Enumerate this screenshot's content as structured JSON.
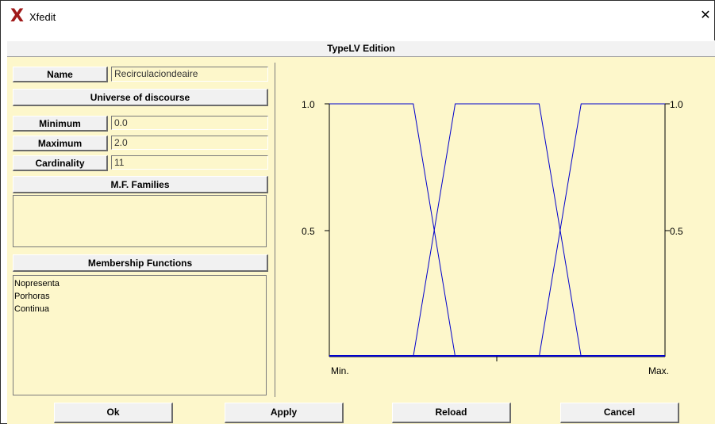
{
  "window": {
    "title": "Xfedit",
    "icon": "x-logo-icon",
    "close_glyph": "✕"
  },
  "header": {
    "title": "TypeLV Edition"
  },
  "name": {
    "label": "Name",
    "value": "Recirculaciondeaire"
  },
  "universe": {
    "label": "Universe of discourse"
  },
  "minimum": {
    "label": "Minimum",
    "value": "0.0"
  },
  "maximum": {
    "label": "Maximum",
    "value": "2.0"
  },
  "cardinality": {
    "label": "Cardinality",
    "value": "11"
  },
  "families": {
    "label": "M.F. Families",
    "items": []
  },
  "membership": {
    "label": "Membership Functions",
    "items": [
      "Nopresenta",
      "Porhoras",
      "Continua"
    ]
  },
  "chart_data": {
    "type": "line",
    "x_labels": [
      "Min.",
      "Max."
    ],
    "y_ticks": [
      "1.0",
      "0.5"
    ],
    "xlim": [
      0,
      2
    ],
    "ylim": [
      0,
      1
    ],
    "line_color": "#0000cc",
    "series": [
      {
        "x": [
          0.0,
          0.5,
          0.75
        ],
        "y": [
          1,
          1,
          0
        ]
      },
      {
        "x": [
          0.5,
          0.75,
          1.25,
          1.5
        ],
        "y": [
          0,
          1,
          1,
          0
        ]
      },
      {
        "x": [
          1.25,
          1.5,
          2.0
        ],
        "y": [
          0,
          1,
          1
        ]
      }
    ]
  },
  "buttons": {
    "ok": "Ok",
    "apply": "Apply",
    "reload": "Reload",
    "cancel": "Cancel"
  }
}
